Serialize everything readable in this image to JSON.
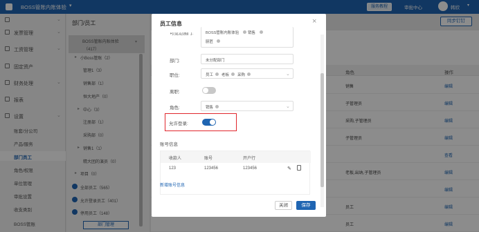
{
  "topbar": {
    "app_title": "BOSS管账内账体验",
    "caret": "▾",
    "tutorial": "服务教程",
    "approval": "审批中心",
    "user": "韩欣",
    "user_caret": "▾"
  },
  "sidebar": {
    "items": [
      {
        "label": "",
        "chev": "⌄"
      },
      {
        "label": "发票管理",
        "chev": "⌄"
      },
      {
        "label": "工资管理",
        "chev": "⌄"
      },
      {
        "label": "固定资产",
        "chev": ""
      },
      {
        "label": "财务处理",
        "chev": "⌄"
      },
      {
        "label": "报表",
        "chev": ""
      },
      {
        "label": "设置",
        "chev": "⌄"
      }
    ],
    "subitems": [
      {
        "label": "账套/分公司",
        "active": false
      },
      {
        "label": "产品/服务",
        "active": false
      },
      {
        "label": "部门员工",
        "active": true
      },
      {
        "label": "角色/权限",
        "active": false
      },
      {
        "label": "单位管理",
        "active": false
      },
      {
        "label": "审批设置",
        "active": false
      },
      {
        "label": "收支类别",
        "active": false
      },
      {
        "label": "BOSS管账",
        "active": false
      }
    ]
  },
  "tree": {
    "title": "部门/员工",
    "root_name": "BOSS管账内账体验",
    "root_count": "（417）",
    "root_caret": "▾",
    "nodes": [
      {
        "label": "小Boss管账（2）",
        "caret": "▸"
      },
      {
        "label": "管理1（3）",
        "caret": ""
      },
      {
        "label": "销售部（1）",
        "caret": ""
      },
      {
        "label": "恒大地产（0）",
        "caret": ""
      },
      {
        "label": "中心（3）",
        "caret": "▸"
      },
      {
        "label": "注册部（1）",
        "caret": ""
      },
      {
        "label": "采购部（0）",
        "caret": ""
      },
      {
        "label": "销售1（1）",
        "caret": "▸"
      },
      {
        "label": "精大团的演员（0）",
        "caret": ""
      },
      {
        "label": "项目（0）",
        "caret": "▸"
      }
    ],
    "groups": [
      {
        "label": "全部员工（565）"
      },
      {
        "label": "允许登录员工（401）"
      },
      {
        "label": "停用员工（148）"
      }
    ],
    "bottom_button": "部门管理"
  },
  "main": {
    "sync_button": "同步钉钉",
    "columns": {
      "role": "角色",
      "op": "操作"
    },
    "rows": [
      {
        "role": "销售",
        "op": "编辑"
      },
      {
        "role": "子管理员",
        "op": "编辑"
      },
      {
        "role": "采购,子管理员",
        "op": "编辑"
      },
      {
        "role": "子管理员",
        "op": "编辑"
      },
      {
        "role": "",
        "op": "查看"
      },
      {
        "role": "老板,出纳,子管理员",
        "op": "编辑"
      },
      {
        "role": "",
        "op": "编辑"
      },
      {
        "role": "员工",
        "op": "编辑"
      },
      {
        "role": "员工",
        "op": "编辑"
      }
    ]
  },
  "modal": {
    "title": "员工信息",
    "close": "×",
    "partial_label": "可见范围门:",
    "partial_tags": [
      "BOSS管账内账体验",
      "销售",
      "厨匠"
    ],
    "dept_label": "部门:",
    "dept_value": "未分配部门",
    "position_label": "职位:",
    "position_tags": [
      "员工",
      "老板",
      "采购"
    ],
    "resign_label": "离职:",
    "resign_on": false,
    "role_label": "角色:",
    "role_tags": [
      "销售"
    ],
    "login_label": "允许登录:",
    "login_on": true,
    "account_section": "账号信息",
    "account_columns": [
      "收款人",
      "账号",
      "开户行"
    ],
    "account_row": [
      "123",
      "123456",
      "123456"
    ],
    "edit_icon": "✎",
    "add_account": "新增账号信息",
    "btn_close": "关闭",
    "btn_save": "保存",
    "accent_color": "#1f65b2",
    "highlight_color": "#e0252b"
  }
}
